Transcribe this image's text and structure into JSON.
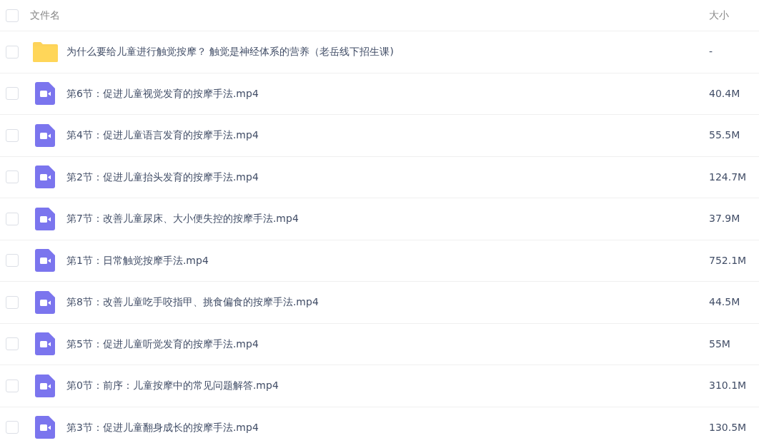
{
  "header": {
    "checked": false,
    "name_label": "文件名",
    "size_label": "大小"
  },
  "rows": [
    {
      "kind": "folder",
      "checked": false,
      "name": "为什么要给儿童进行触觉按摩？ 触觉是神经体系的营养（老岳线下招生课)",
      "size": "-"
    },
    {
      "kind": "video",
      "checked": false,
      "name": "第6节：促进儿童视觉发育的按摩手法.mp4",
      "size": "40.4M"
    },
    {
      "kind": "video",
      "checked": false,
      "name": "第4节：促进儿童语言发育的按摩手法.mp4",
      "size": "55.5M"
    },
    {
      "kind": "video",
      "checked": false,
      "name": "第2节：促进儿童抬头发育的按摩手法.mp4",
      "size": "124.7M"
    },
    {
      "kind": "video",
      "checked": false,
      "name": "第7节：改善儿童尿床、大小便失控的按摩手法.mp4",
      "size": "37.9M"
    },
    {
      "kind": "video",
      "checked": false,
      "name": "第1节：日常触觉按摩手法.mp4",
      "size": "752.1M"
    },
    {
      "kind": "video",
      "checked": false,
      "name": "第8节：改善儿童吃手咬指甲、挑食偏食的按摩手法.mp4",
      "size": "44.5M"
    },
    {
      "kind": "video",
      "checked": false,
      "name": "第5节：促进儿童听觉发育的按摩手法.mp4",
      "size": "55M"
    },
    {
      "kind": "video",
      "checked": false,
      "name": "第0节：前序：儿童按摩中的常见问题解答.mp4",
      "size": "310.1M"
    },
    {
      "kind": "video",
      "checked": false,
      "name": "第3节：促进儿童翻身成长的按摩手法.mp4",
      "size": "130.5M"
    }
  ]
}
